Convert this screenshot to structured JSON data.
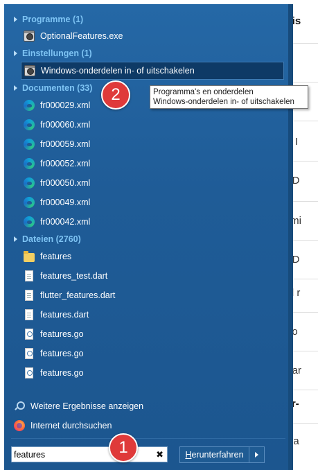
{
  "background": {
    "lines": [
      {
        "text": "chnis",
        "bold": true
      },
      {
        "text": "and",
        "bold": false
      },
      {
        "text": "with I",
        "bold": false
      },
      {
        "text": "sist D",
        "bold": false
      },
      {
        "text": "ynami",
        "bold": false
      },
      {
        "text": "sist D",
        "bold": false
      },
      {
        "text": "rtual r",
        "bold": false
      },
      {
        "text": "e Wo",
        "bold": false
      },
      {
        "text": "V Mar",
        "bold": false
      },
      {
        "text": "yper-",
        "bold": true
      },
      {
        "text": "virtua",
        "bold": false
      }
    ]
  },
  "sections": {
    "programme": {
      "label": "Programme (1)"
    },
    "einstellungen": {
      "label": "Einstellungen (1)"
    },
    "documenten": {
      "label": "Documenten (33)"
    },
    "dateien": {
      "label": "Dateien (2760)"
    }
  },
  "programme_items": [
    {
      "label": "OptionalFeatures.exe",
      "icon": "settings-app-icon"
    }
  ],
  "einstellungen_items": [
    {
      "label": "Windows-onderdelen in- of uitschakelen",
      "icon": "settings-app-icon",
      "selected": true
    }
  ],
  "documenten_items": [
    {
      "label": "fr000029.xml",
      "icon": "edge-browser-icon"
    },
    {
      "label": "fr000060.xml",
      "icon": "edge-browser-icon"
    },
    {
      "label": "fr000059.xml",
      "icon": "edge-browser-icon"
    },
    {
      "label": "fr000052.xml",
      "icon": "edge-browser-icon"
    },
    {
      "label": "fr000050.xml",
      "icon": "edge-browser-icon"
    },
    {
      "label": "fr000049.xml",
      "icon": "edge-browser-icon"
    },
    {
      "label": "fr000042.xml",
      "icon": "edge-browser-icon"
    }
  ],
  "dateien_items": [
    {
      "label": "features",
      "icon": "folder-icon"
    },
    {
      "label": "features_test.dart",
      "icon": "file-icon"
    },
    {
      "label": "flutter_features.dart",
      "icon": "file-icon"
    },
    {
      "label": "features.dart",
      "icon": "file-icon"
    },
    {
      "label": "features.go",
      "icon": "go-file-icon"
    },
    {
      "label": "features.go",
      "icon": "go-file-icon"
    },
    {
      "label": "features.go",
      "icon": "go-file-icon"
    }
  ],
  "footer": {
    "more_results": "Weitere Ergebnisse anzeigen",
    "search_internet": "Internet durchsuchen"
  },
  "search": {
    "value": "features",
    "clear_symbol": "✖"
  },
  "shutdown": {
    "first_letter": "H",
    "rest": "erunterfahren"
  },
  "tooltip": {
    "line1": "Programma's en onderdelen",
    "line2": "Windows-onderdelen in- of uitschakelen"
  },
  "badges": {
    "one": "1",
    "two": "2"
  },
  "colors": {
    "menu_background": "#1f5c97",
    "section_header": "#7ec4f4",
    "selected_item": "#0e3a66",
    "badge": "#df3a3a"
  }
}
